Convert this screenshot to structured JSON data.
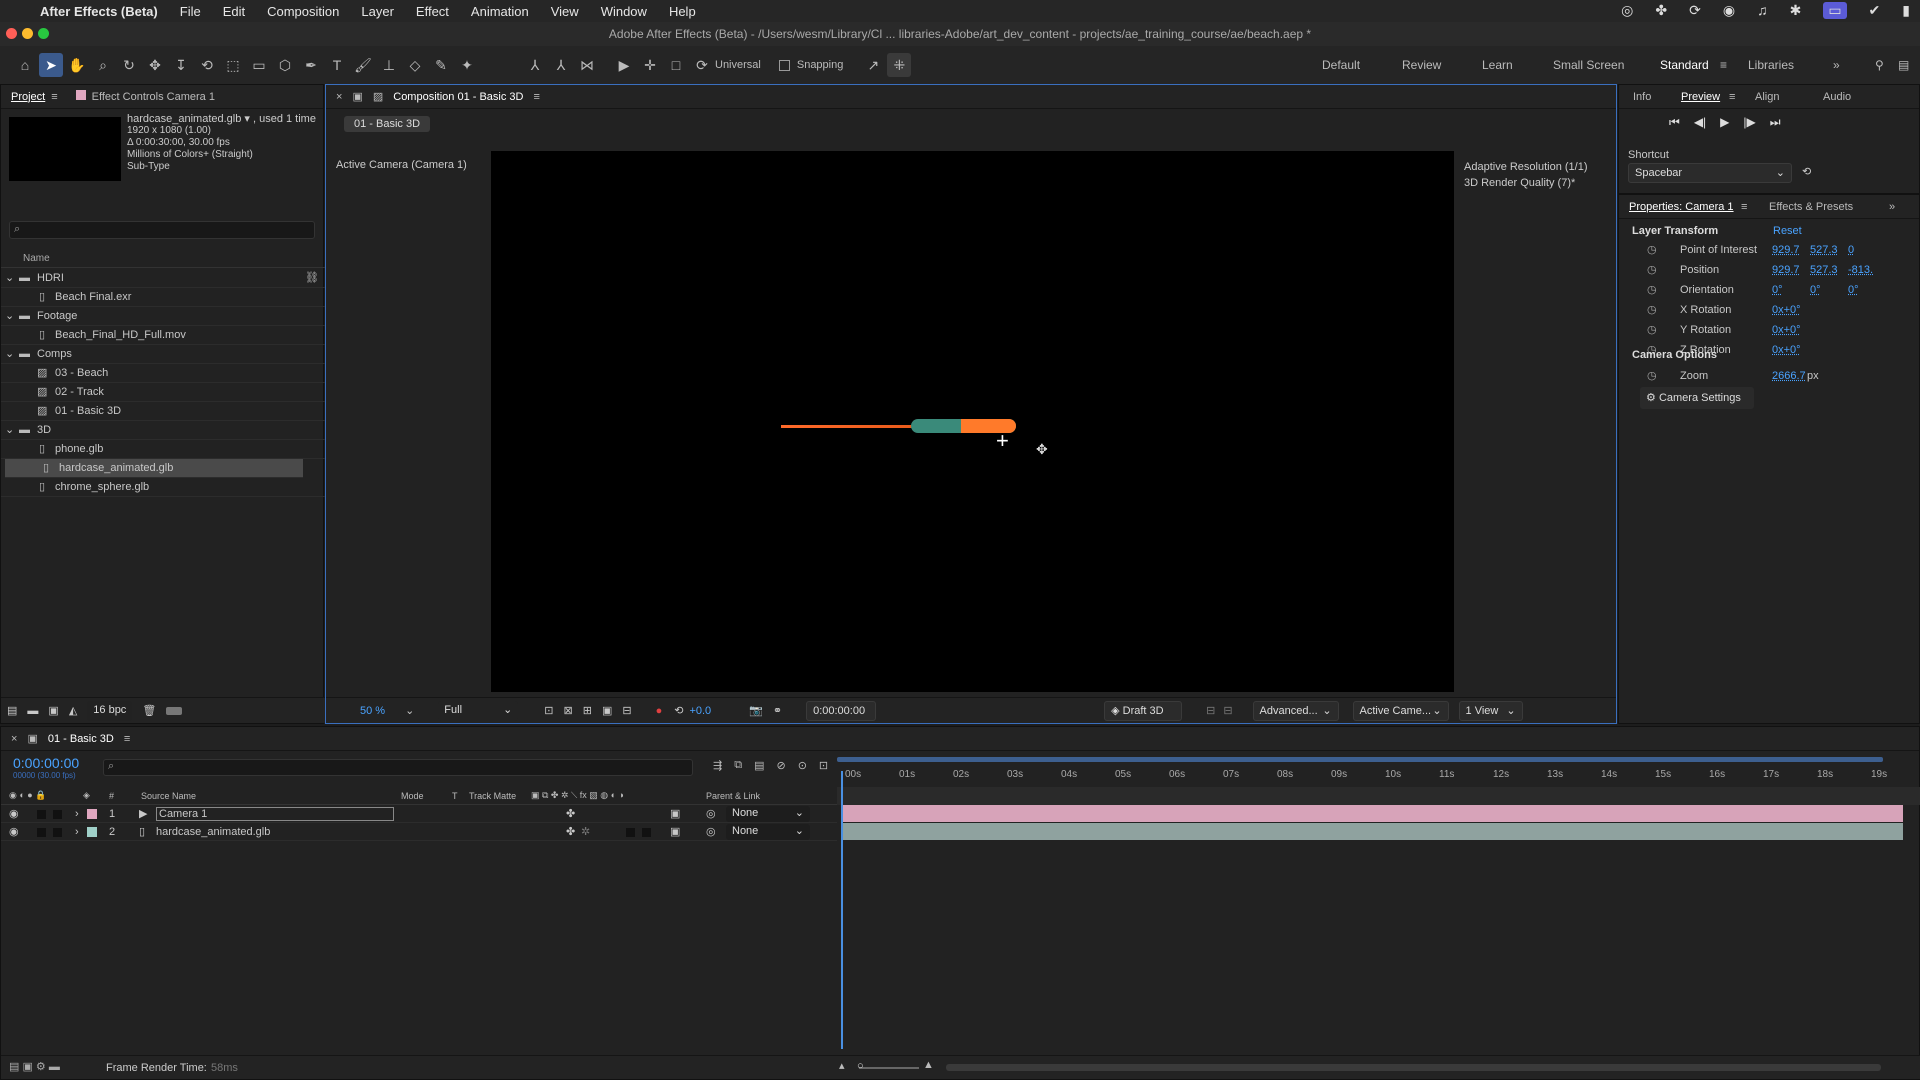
{
  "menubar": {
    "app": "After Effects (Beta)",
    "items": [
      "File",
      "Edit",
      "Composition",
      "Layer",
      "Effect",
      "Animation",
      "View",
      "Window",
      "Help"
    ]
  },
  "titlebar": {
    "title": "Adobe After Effects (Beta) - /Users/wesm/Library/Cl ... libraries-Adobe/art_dev_content - projects/ae_training_course/ae/beach.aep *"
  },
  "toolbar": {
    "universal": "Universal",
    "snapping": "Snapping",
    "workspaces": [
      "Default",
      "Review",
      "Learn",
      "Small Screen",
      "Standard",
      "Libraries"
    ],
    "active_workspace": "Standard"
  },
  "project": {
    "tabs": [
      "Project",
      "Effect Controls Camera 1"
    ],
    "info": {
      "name": "hardcase_animated.glb ▾ , used 1 time",
      "dims": "1920 x 1080 (1.00)",
      "duration": "Δ 0:00:30:00, 30.00 fps",
      "colors": "Millions of Colors+ (Straight)",
      "subtype": "Sub-Type"
    },
    "search_placeholder": "",
    "col_name": "Name",
    "items": [
      {
        "label": "HDRI",
        "type": "folder",
        "level": 0
      },
      {
        "label": "Beach Final.exr",
        "type": "file",
        "level": 1
      },
      {
        "label": "Footage",
        "type": "folder",
        "level": 0
      },
      {
        "label": "Beach_Final_HD_Full.mov",
        "type": "file",
        "level": 1
      },
      {
        "label": "Comps",
        "type": "folder",
        "level": 0
      },
      {
        "label": "03 - Beach",
        "type": "comp",
        "level": 1
      },
      {
        "label": "02 - Track",
        "type": "comp",
        "level": 1
      },
      {
        "label": "01 - Basic 3D",
        "type": "comp",
        "level": 1
      },
      {
        "label": "3D",
        "type": "folder",
        "level": 0
      },
      {
        "label": "phone.glb",
        "type": "file",
        "level": 1
      },
      {
        "label": "hardcase_animated.glb",
        "type": "file",
        "level": 1,
        "selected": true
      },
      {
        "label": "chrome_sphere.glb",
        "type": "file",
        "level": 1
      }
    ],
    "bpc": "16 bpc"
  },
  "composition": {
    "tab": "Composition 01 - Basic 3D",
    "chip": "01 - Basic 3D",
    "camera_label": "Active Camera (Camera 1)",
    "res_label": "Adaptive Resolution (1/1)",
    "quality_label": "3D Render Quality (7)*",
    "zoom": "50 %",
    "resolution": "Full",
    "exposure": "+0.0",
    "timecode": "0:00:00:00",
    "draft": "Draft 3D",
    "advanced": "Advanced...",
    "active_cam": "Active Came...",
    "views": "1 View"
  },
  "right": {
    "top_tabs": [
      "Info",
      "Preview",
      "Align",
      "Audio"
    ],
    "shortcut_label": "Shortcut",
    "shortcut_value": "Spacebar",
    "props_tab": "Properties: Camera 1",
    "effects_tab": "Effects & Presets",
    "layer_transform": "Layer Transform",
    "reset": "Reset",
    "props": [
      {
        "name": "Point of Interest",
        "values": [
          "929.7",
          "527.3",
          "0"
        ]
      },
      {
        "name": "Position",
        "values": [
          "929.7",
          "527.3",
          "-813."
        ]
      },
      {
        "name": "Orientation",
        "values": [
          "0°",
          "0°",
          "0°"
        ]
      },
      {
        "name": "X Rotation",
        "values": [
          "0x+0°"
        ]
      },
      {
        "name": "Y Rotation",
        "values": [
          "0x+0°"
        ]
      },
      {
        "name": "Z Rotation",
        "values": [
          "0x+0°"
        ]
      }
    ],
    "camera_options": "Camera Options",
    "zoom_label": "Zoom",
    "zoom_value": "2666.7",
    "zoom_unit": "px",
    "camera_settings": "Camera Settings"
  },
  "timeline": {
    "tab": "01 - Basic 3D",
    "timecode": "0:00:00:00",
    "fps": "00000 (30.00 fps)",
    "cols": {
      "source": "Source Name",
      "mode": "Mode",
      "t": "T",
      "matte": "Track Matte",
      "parent": "Parent & Link"
    },
    "ruler": [
      "00s",
      "01s",
      "02s",
      "03s",
      "04s",
      "05s",
      "06s",
      "07s",
      "08s",
      "09s",
      "10s",
      "11s",
      "12s",
      "13s",
      "14s",
      "15s",
      "16s",
      "17s",
      "18s",
      "19s"
    ],
    "layers": [
      {
        "num": "1",
        "name": "Camera 1",
        "parent": "None",
        "color": "#e0a7c0"
      },
      {
        "num": "2",
        "name": "hardcase_animated.glb",
        "parent": "None",
        "color": "#9fd0c8"
      }
    ],
    "render_time_label": "Frame Render Time:",
    "render_time": "58ms"
  }
}
